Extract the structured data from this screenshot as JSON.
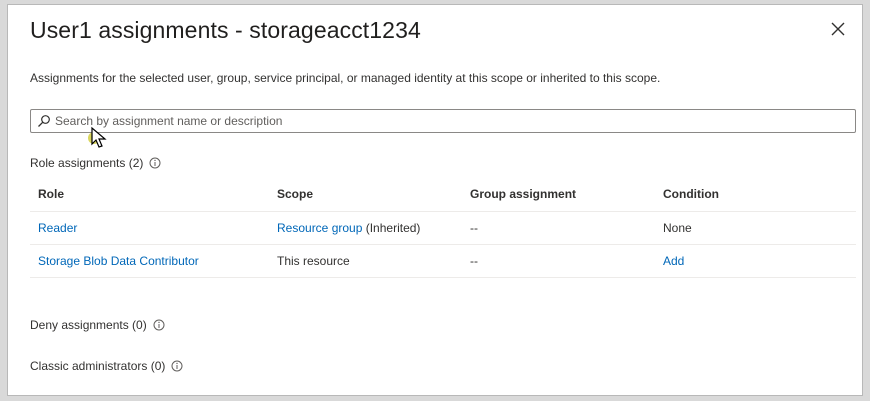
{
  "dialog": {
    "title": "User1 assignments - storageacct1234",
    "description": "Assignments for the selected user, group, service principal, or managed identity at this scope or inherited to this scope.",
    "close_icon": "close-icon"
  },
  "search": {
    "placeholder": "Search by assignment name or description",
    "value": "",
    "icon": "search-icon"
  },
  "role_assignments": {
    "label": "Role assignments (2)",
    "columns": [
      "Role",
      "Scope",
      "Group assignment",
      "Condition"
    ],
    "rows": [
      {
        "role": "Reader",
        "scope_link": "Resource group",
        "scope_suffix": " (Inherited)",
        "group": "--",
        "condition": "None"
      },
      {
        "role": "Storage Blob Data Contributor",
        "scope_link": "",
        "scope_suffix": "This resource",
        "group": "--",
        "condition": "Add"
      }
    ]
  },
  "deny_assignments": {
    "label": "Deny assignments (0)"
  },
  "classic_admins": {
    "label": "Classic administrators (0)"
  },
  "colors": {
    "link": "#0067b8",
    "text": "#323130",
    "border": "#8a8886"
  }
}
